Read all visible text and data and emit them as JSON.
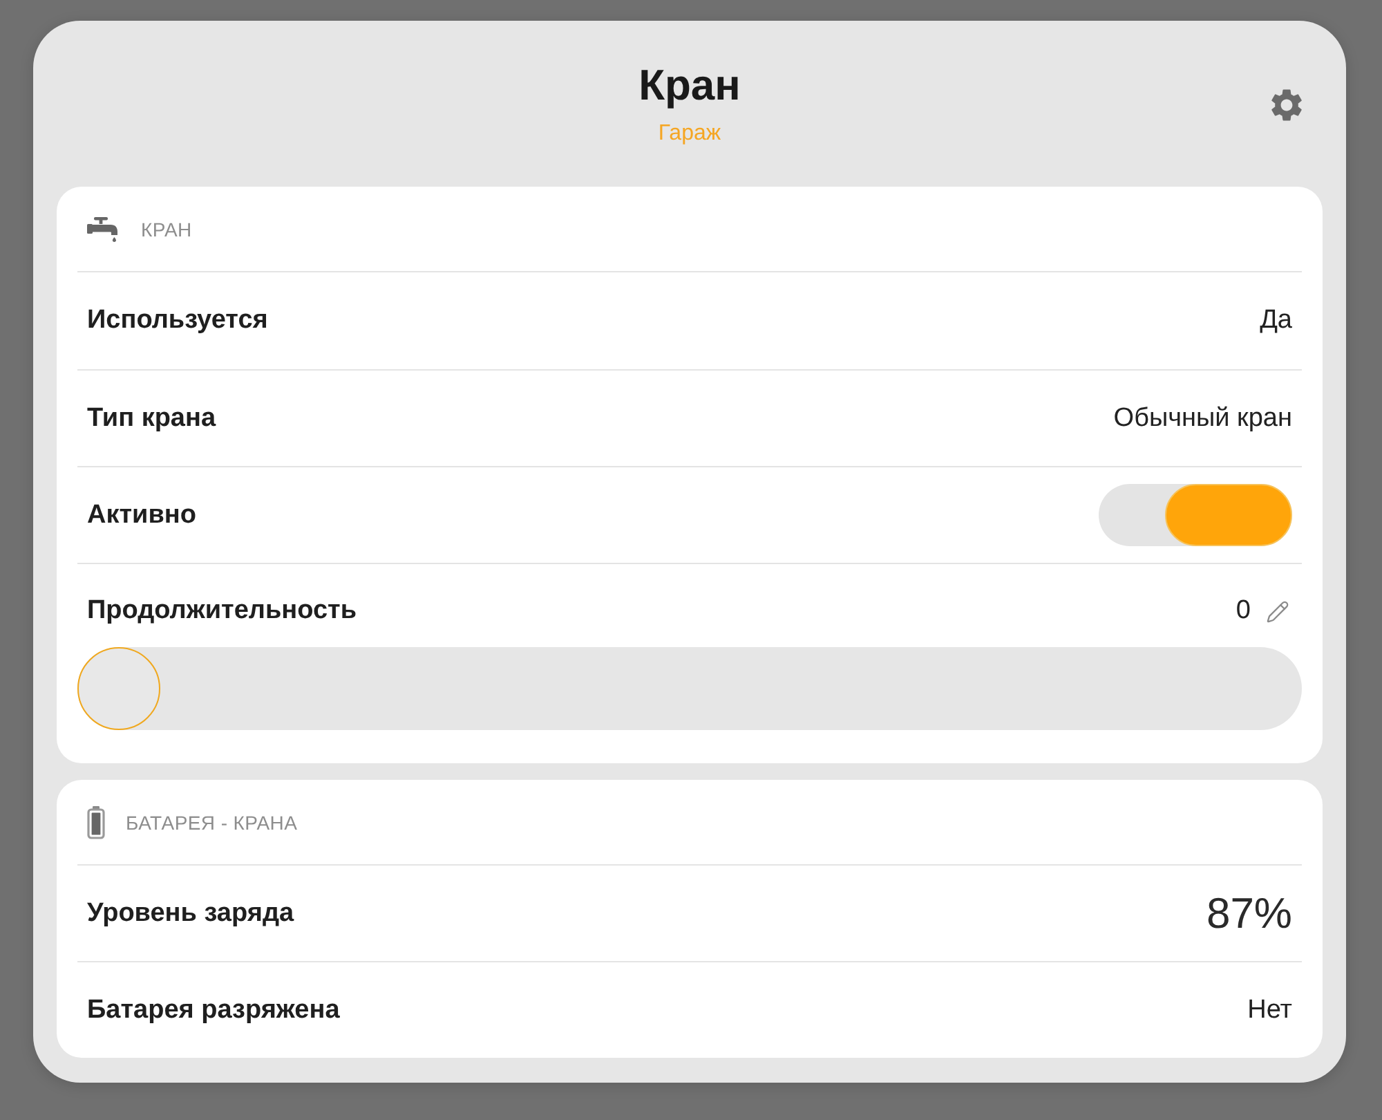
{
  "header": {
    "title": "Кран",
    "subtitle": "Гараж"
  },
  "sections": [
    {
      "title": "КРАН",
      "rows": [
        {
          "kind": "value",
          "label": "Используется",
          "value": "Да"
        },
        {
          "kind": "value",
          "label": "Тип крана",
          "value": "Обычный кран"
        },
        {
          "kind": "switch",
          "label": "Активно",
          "on": true
        },
        {
          "kind": "slider",
          "label": "Продолжительность",
          "value": "0",
          "level": 0
        }
      ]
    },
    {
      "title": "БАТАРЕЯ - КРАНА",
      "rows": [
        {
          "kind": "big_value",
          "label": "Уровень заряда",
          "value": "87%"
        },
        {
          "kind": "value",
          "label": "Батарея разряжена",
          "value": "Нет"
        }
      ]
    }
  ]
}
